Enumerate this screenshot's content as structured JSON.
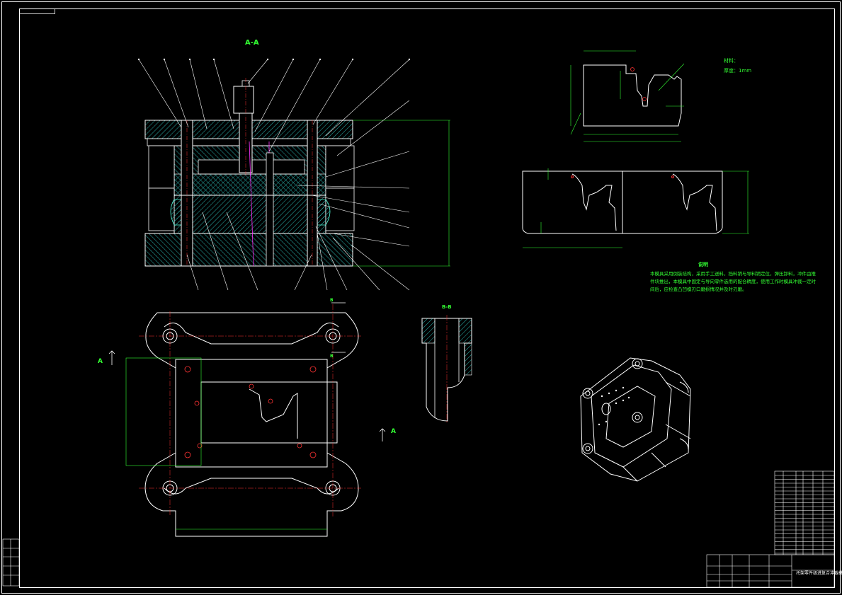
{
  "colors": {
    "background": "#000000",
    "outline": "#ffffff",
    "hatch": "#2bb5b0",
    "text": "#33ff33",
    "dimension": "#33ff33",
    "center_line": "#ff3333",
    "magenta": "#ff33ff"
  },
  "section_labels": {
    "aa": "A-A",
    "bb": "B-B",
    "a_left": "A",
    "a_right": "A",
    "b_top": "B",
    "b_bottom": "B"
  },
  "material": {
    "material_line": "材料：",
    "thickness_line": "厚度：1mm"
  },
  "notes": {
    "title": "说明",
    "text": "本模具采用倒装结构，采用手工送料，挡料销与导料销定位，弹压卸料，冲件由推件块推出，本模具中固定与导向零件选用的配合精度，使用工作时模具冲裁一定时间后，应检查凸凹模刃口磨损情况并及时刃磨。"
  },
  "title_block": {
    "drawing_title": "托架零件级进复合冲裁模"
  }
}
